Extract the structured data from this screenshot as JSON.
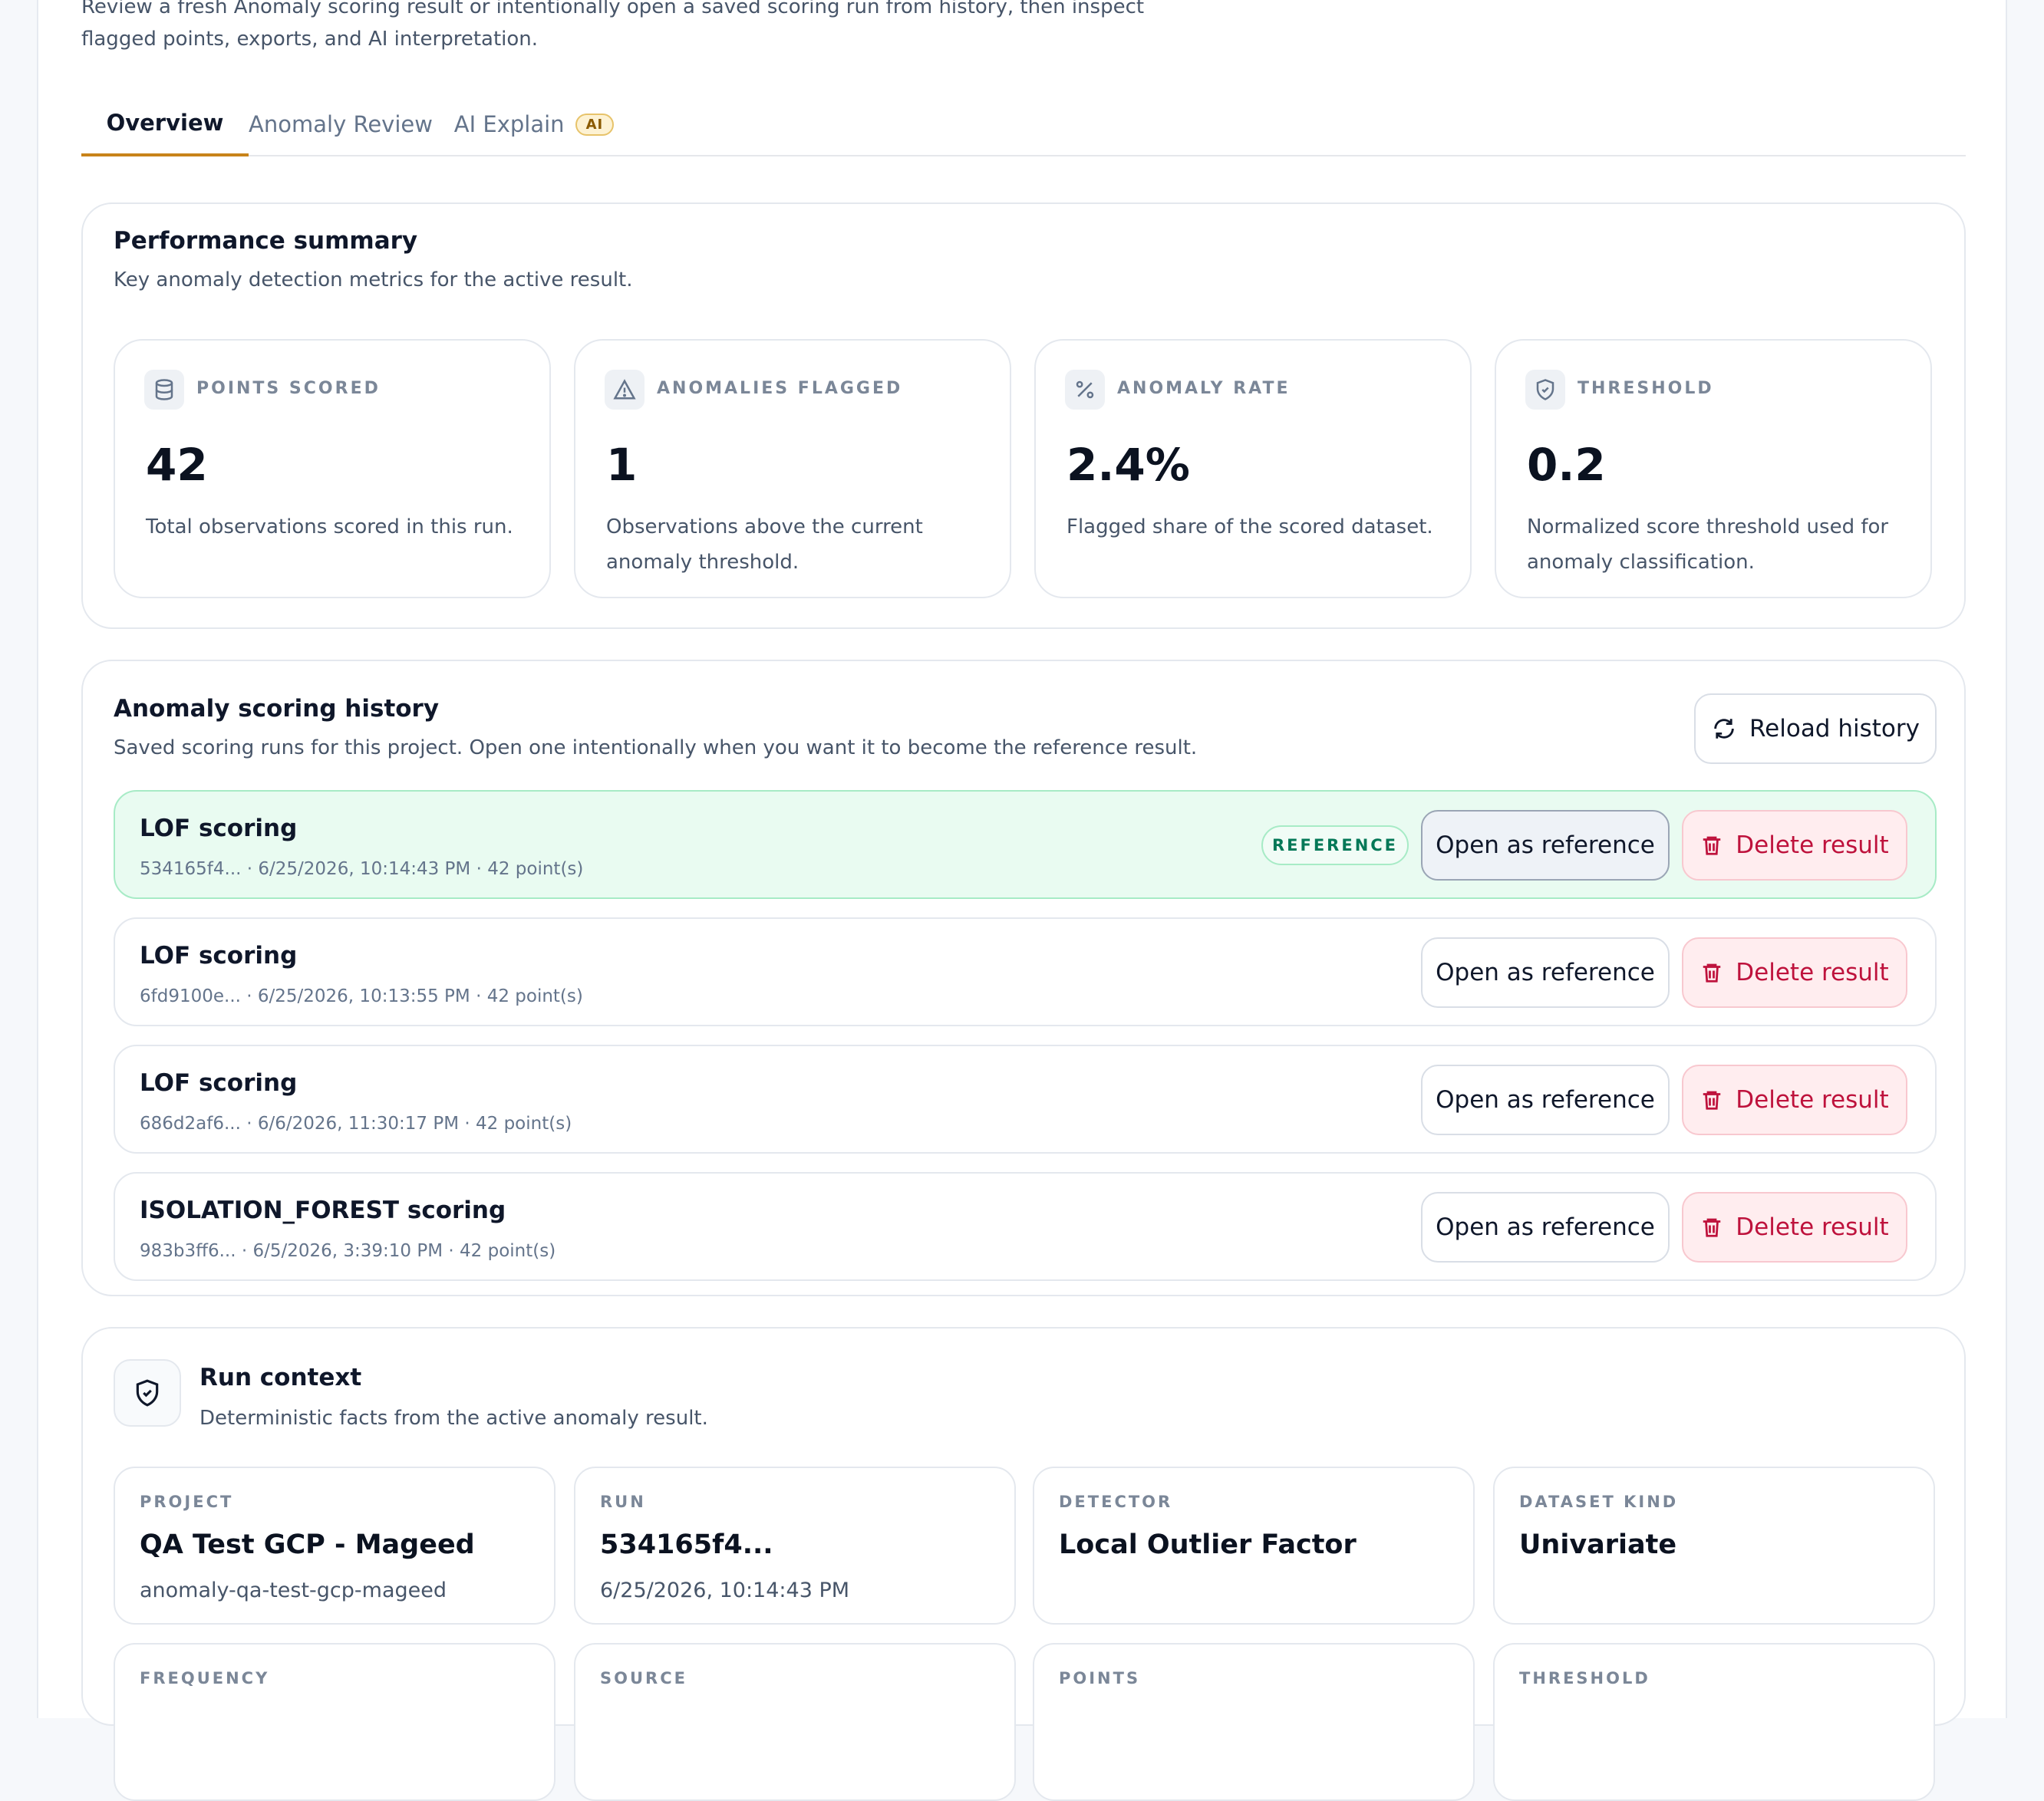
{
  "intro": {
    "line1": "Review a fresh Anomaly scoring result or intentionally open a saved scoring run from history, then inspect",
    "line2": "flagged points, exports, and AI interpretation."
  },
  "tabs": [
    {
      "label": "Overview",
      "active": true
    },
    {
      "label": "Anomaly Review",
      "active": false
    },
    {
      "label": "AI Explain",
      "active": false,
      "badge": "AI"
    }
  ],
  "performance": {
    "title": "Performance summary",
    "subtitle": "Key anomaly detection metrics for the active result.",
    "metrics": [
      {
        "icon": "database-icon",
        "label": "POINTS SCORED",
        "value": "42",
        "description": "Total observations scored in this run."
      },
      {
        "icon": "warning-triangle-icon",
        "label": "ANOMALIES FLAGGED",
        "value": "1",
        "description": "Observations above the current anomaly threshold."
      },
      {
        "icon": "percent-icon",
        "label": "ANOMALY RATE",
        "value": "2.4%",
        "description": "Flagged share of the scored dataset."
      },
      {
        "icon": "shield-check-icon",
        "label": "THRESHOLD",
        "value": "0.2",
        "description": "Normalized score threshold used for anomaly classification."
      }
    ]
  },
  "history": {
    "title": "Anomaly scoring history",
    "subtitle": "Saved scoring runs for this project. Open one intentionally when you want it to become the reference result.",
    "reload_label": "Reload history",
    "reference_badge": "REFERENCE",
    "open_label": "Open as reference",
    "delete_label": "Delete result",
    "runs": [
      {
        "title": "LOF scoring",
        "meta": "534165f4... · 6/25/2026, 10:14:43 PM · 42 point(s)",
        "is_reference": true
      },
      {
        "title": "LOF scoring",
        "meta": "6fd9100e... · 6/25/2026, 10:13:55 PM · 42 point(s)",
        "is_reference": false
      },
      {
        "title": "LOF scoring",
        "meta": "686d2af6... · 6/6/2026, 11:30:17 PM · 42 point(s)",
        "is_reference": false
      },
      {
        "title": "ISOLATION_FOREST scoring",
        "meta": "983b3ff6... · 6/5/2026, 3:39:10 PM · 42 point(s)",
        "is_reference": false
      }
    ]
  },
  "context": {
    "title": "Run context",
    "subtitle": "Deterministic facts from the active anomaly result.",
    "facts": [
      {
        "label": "PROJECT",
        "value": "QA Test GCP - Mageed",
        "sub": "anomaly-qa-test-gcp-mageed"
      },
      {
        "label": "RUN",
        "value": "534165f4...",
        "sub": "6/25/2026, 10:14:43 PM"
      },
      {
        "label": "DETECTOR",
        "value": "Local Outlier Factor",
        "sub": ""
      },
      {
        "label": "DATASET KIND",
        "value": "Univariate",
        "sub": ""
      }
    ],
    "facts_row2": [
      {
        "label": "FREQUENCY"
      },
      {
        "label": "SOURCE"
      },
      {
        "label": "POINTS"
      },
      {
        "label": "THRESHOLD"
      }
    ]
  },
  "colors": {
    "accent": "#c8831a",
    "reference_bg": "#e9fbf1",
    "danger": "#be123c"
  }
}
